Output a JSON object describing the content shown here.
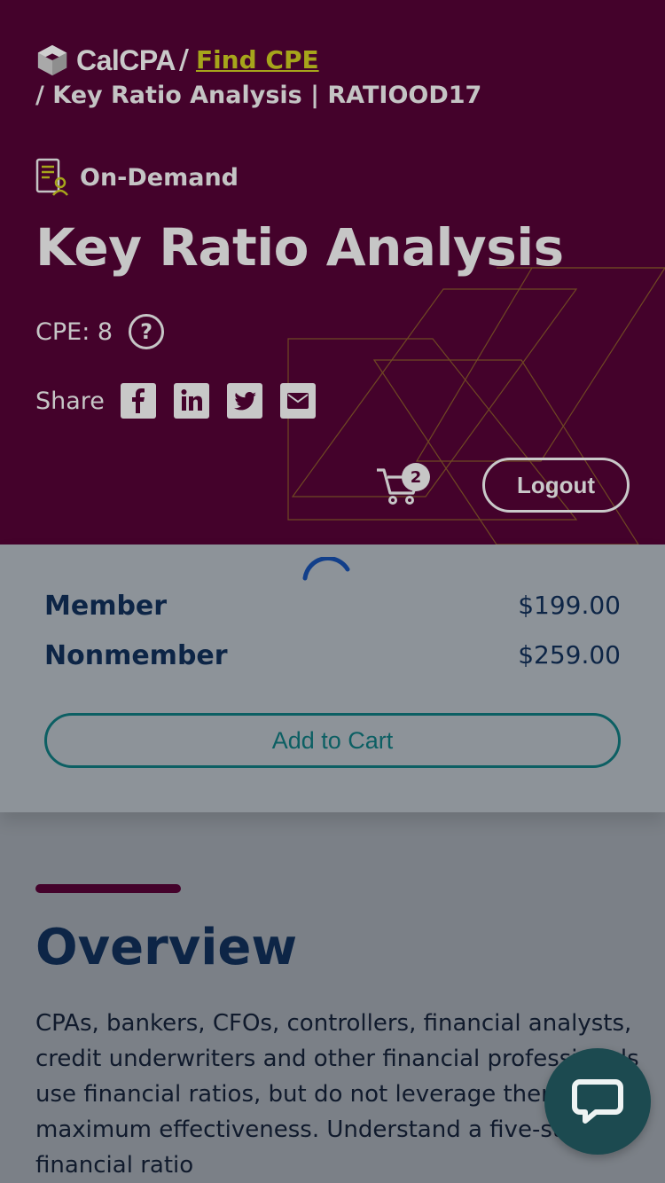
{
  "brand": {
    "name": "CalCPA"
  },
  "breadcrumb": {
    "sep": "/",
    "link": "Find CPE",
    "current": "/ Key Ratio Analysis | RATIOOD17"
  },
  "course": {
    "format": "On-Demand",
    "title": "Key Ratio Analysis",
    "cpe": "CPE: 8",
    "help_glyph": "?"
  },
  "share": {
    "label": "Share",
    "icons": [
      "facebook-icon",
      "linkedin-icon",
      "twitter-icon",
      "email-icon"
    ]
  },
  "cart": {
    "count": "2"
  },
  "header_actions": {
    "logout": "Logout"
  },
  "pricing": {
    "rows": [
      {
        "name": "Member",
        "price": "$199.00"
      },
      {
        "name": "Nonmember",
        "price": "$259.00"
      }
    ],
    "add_to_cart": "Add to Cart"
  },
  "overview": {
    "title": "Overview",
    "text": "CPAs, bankers, CFOs, controllers, financial analysts, credit underwriters and other financial professionals use financial ratios, but do not leverage them for maximum effectiveness. Understand a five-step key financial ratio"
  },
  "colors": {
    "hero_bg": "#44022b",
    "accent_link": "#a6a51b",
    "teal": "#0c5f63",
    "navy": "#0d2546",
    "chat": "#1c4a50"
  }
}
